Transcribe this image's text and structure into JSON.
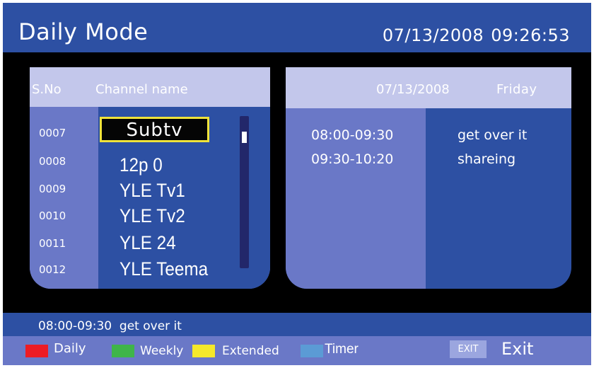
{
  "header": {
    "title": "Daily Mode",
    "date": "07/13/2008",
    "time": "09:26:53"
  },
  "channel_list": {
    "col_number": "S.No",
    "col_name": "Channel name",
    "selected_index": 0,
    "rows": [
      {
        "number": "0007",
        "name": "Subtv"
      },
      {
        "number": "0008",
        "name": "12p 0"
      },
      {
        "number": "0009",
        "name": "YLE Tv1"
      },
      {
        "number": "0010",
        "name": "YLE Tv2"
      },
      {
        "number": "0011",
        "name": "YLE 24"
      },
      {
        "number": "0012",
        "name": "YLE Teema"
      }
    ]
  },
  "schedule": {
    "date": "07/13/2008",
    "day": "Friday",
    "entries": [
      {
        "time": "08:00-09:30",
        "program": "get over it"
      },
      {
        "time": "09:30-10:20",
        "program": "shareing"
      }
    ]
  },
  "info_bar": {
    "text": "08:00-09:30  get over it"
  },
  "legend": {
    "daily": "Daily",
    "weekly": "Weekly",
    "extended": "Extended",
    "timer": "Timer",
    "exit_key": "EXIT",
    "exit_label": "Exit"
  },
  "colors": {
    "header_blue": "#2d50a3",
    "panel_light": "#6a78c7",
    "panel_header": "#c3c7eb",
    "selection_border": "#f0e33a",
    "key_red": "#ed1c24",
    "key_green": "#3fb549",
    "key_yellow": "#f5e92a",
    "key_blue": "#5b9bd5"
  }
}
